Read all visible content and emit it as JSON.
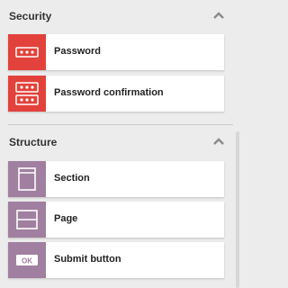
{
  "security": {
    "title": "Security",
    "toggle_icon": "chevron-up-icon",
    "items": [
      {
        "label": "Password",
        "icon": "password-icon",
        "color": "#e2423b"
      },
      {
        "label": "Password confirmation",
        "icon": "password-confirmation-icon",
        "color": "#e2423b"
      }
    ]
  },
  "structure": {
    "title": "Structure",
    "toggle_icon": "chevron-up-icon",
    "items": [
      {
        "label": "Section",
        "icon": "section-icon",
        "color": "#a17fa0"
      },
      {
        "label": "Page",
        "icon": "page-icon",
        "color": "#a17fa0"
      },
      {
        "label": "Submit button",
        "icon": "submit-button-icon",
        "color": "#a17fa0",
        "badge": "OK"
      }
    ]
  }
}
